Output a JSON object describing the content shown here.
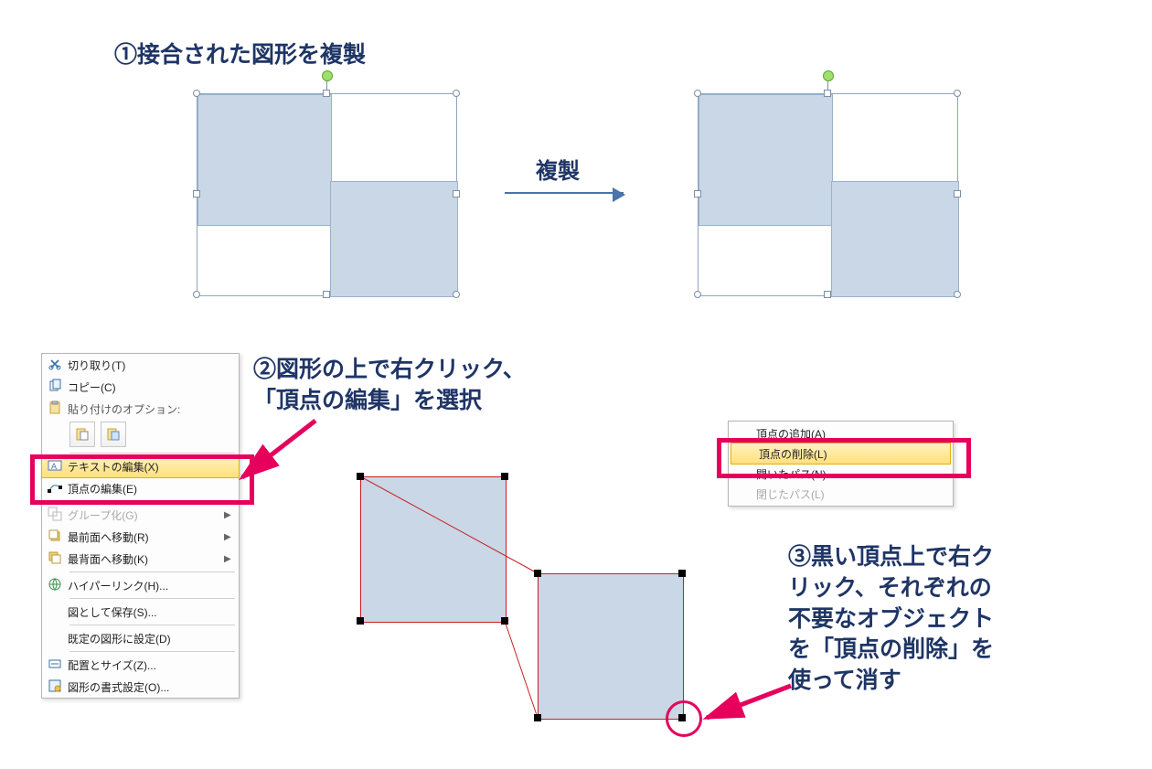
{
  "step1_heading": "①接合された図形を複製",
  "duplicate_label": "複製",
  "step2_heading": "②図形の上で右クリック、\n「頂点の編集」を選択",
  "step3_heading": "③黒い頂点上で右ク\nリック、それぞれの\n不要なオブジェクト\nを「頂点の削除」を\n使って消す",
  "context_menu": {
    "cut": "切り取り(T)",
    "copy": "コピー(C)",
    "paste_header": "貼り付けのオプション:",
    "edit_text": "テキストの編集(X)",
    "edit_points": "頂点の編集(E)",
    "group": "グループ化(G)",
    "bring_front": "最前面へ移動(R)",
    "send_back": "最背面へ移動(K)",
    "hyperlink": "ハイパーリンク(H)...",
    "save_as_pic": "図として保存(S)...",
    "set_default": "既定の図形に設定(D)",
    "size_pos": "配置とサイズ(Z)...",
    "format_shape": "図形の書式設定(O)..."
  },
  "vertex_menu": {
    "add_point": "頂点の追加(A)",
    "delete_point": "頂点の削除(L)",
    "open_path": "開いたパス(N)",
    "closed_path": "閉じたパス(L)"
  }
}
